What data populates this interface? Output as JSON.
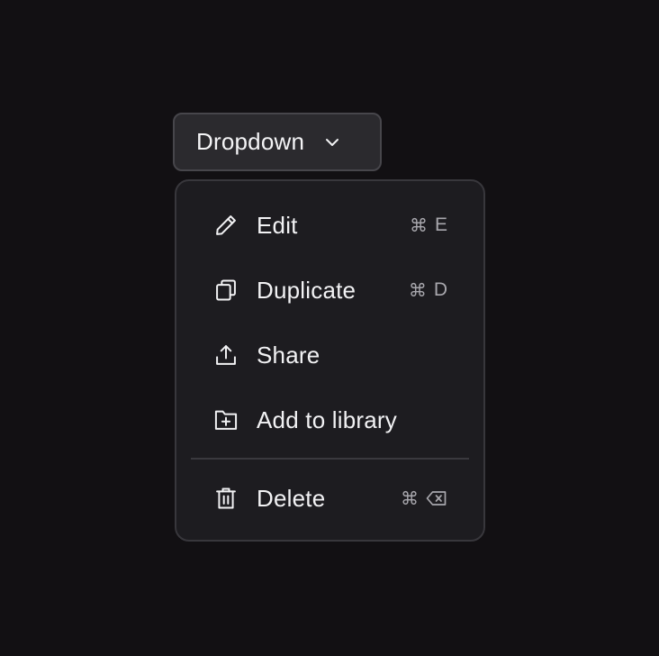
{
  "trigger": {
    "label": "Dropdown",
    "icon": "chevron-down-icon"
  },
  "menu": {
    "items": [
      {
        "label": "Edit",
        "icon": "pencil-icon",
        "shortcut_cmd": "⌘",
        "shortcut_key": "E"
      },
      {
        "label": "Duplicate",
        "icon": "copy-icon",
        "shortcut_cmd": "⌘",
        "shortcut_key": "D"
      },
      {
        "label": "Share",
        "icon": "share-icon",
        "shortcut_cmd": "",
        "shortcut_key": ""
      },
      {
        "label": "Add to library",
        "icon": "folder-plus-icon",
        "shortcut_cmd": "",
        "shortcut_key": ""
      }
    ],
    "danger_items": [
      {
        "label": "Delete",
        "icon": "trash-icon",
        "shortcut_cmd": "⌘",
        "shortcut_key_icon": "backspace-icon"
      }
    ]
  },
  "colors": {
    "background": "#121013",
    "trigger_bg": "#2b2a2e",
    "menu_bg": "#1d1c20",
    "text": "#f2f2f4",
    "shortcut_text": "#a8a7ad"
  }
}
